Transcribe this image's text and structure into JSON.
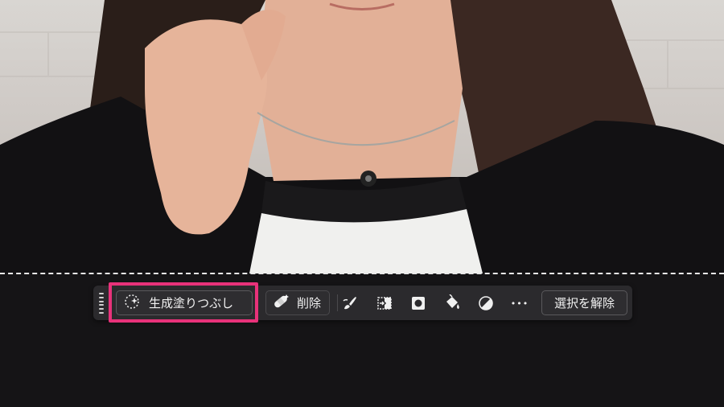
{
  "canvas": {
    "image_subject": "Person in black hoodie with pendant necklace"
  },
  "toolbar": {
    "generative_fill_label": "生成塗りつぶし",
    "remove_label": "削除",
    "deselect_label": "選択を解除",
    "more_label": "•••"
  },
  "icons": {
    "grip": "drag-handle-icon",
    "generative_fill": "sparkle-selection-icon",
    "remove": "bandage-icon",
    "brush": "brush-icon",
    "transform": "transform-selection-icon",
    "mask": "mask-icon",
    "fill": "paint-bucket-icon",
    "adjust": "adjustment-icon"
  },
  "colors": {
    "highlight": "#e8327a",
    "bar": "#2b2a2d",
    "background": "#151416"
  }
}
